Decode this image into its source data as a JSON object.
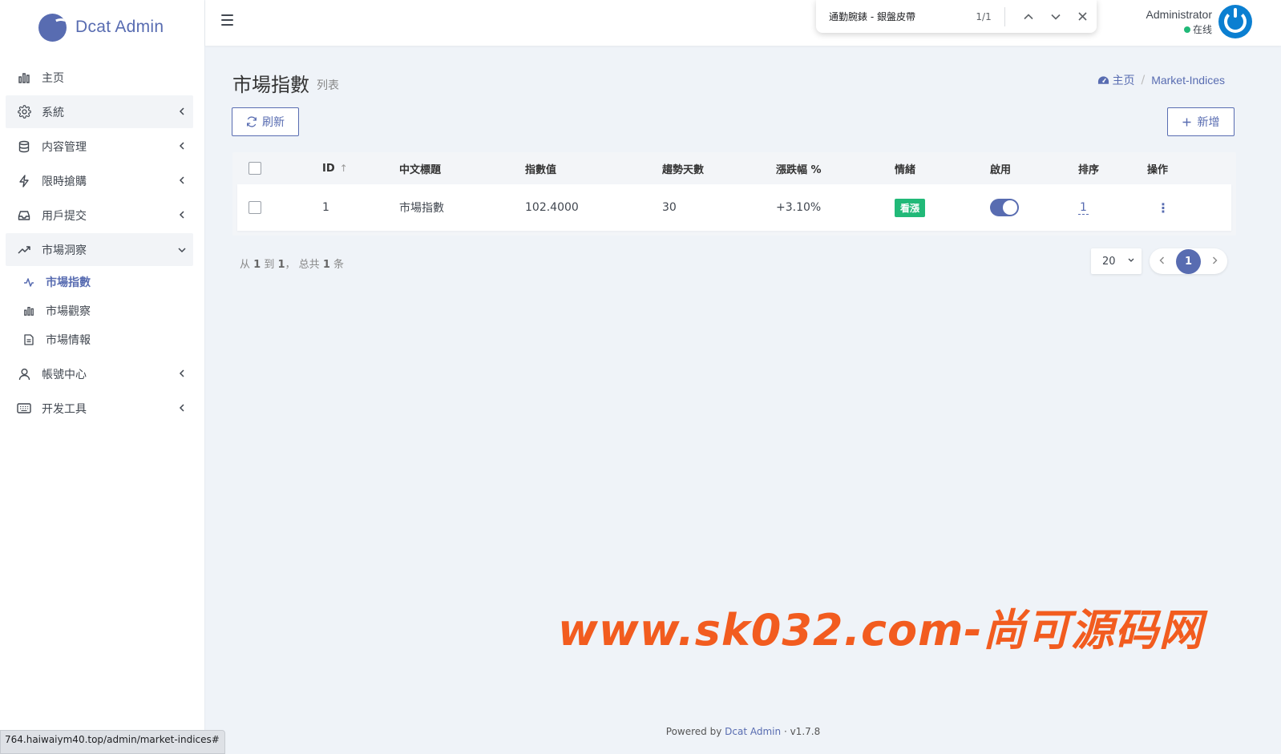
{
  "brand": {
    "name": "Dcat Admin"
  },
  "sidebar": {
    "items": [
      {
        "label": "主页",
        "icon": "bar-chart-icon",
        "expandable": false
      },
      {
        "label": "系統",
        "icon": "gear-icon",
        "expandable": true
      },
      {
        "label": "内容管理",
        "icon": "database-icon",
        "expandable": true
      },
      {
        "label": "限時搶購",
        "icon": "lightning-icon",
        "expandable": true
      },
      {
        "label": "用戶提交",
        "icon": "inbox-icon",
        "expandable": true
      },
      {
        "label": "市場洞察",
        "icon": "trend-up-icon",
        "expandable": true,
        "expanded": true
      },
      {
        "label": "帳號中心",
        "icon": "user-icon",
        "expandable": true
      },
      {
        "label": "开发工具",
        "icon": "keyboard-icon",
        "expandable": true
      }
    ],
    "submenu": [
      {
        "label": "市場指數",
        "icon": "pulse-icon",
        "active": true
      },
      {
        "label": "市場觀察",
        "icon": "bar-chart-icon",
        "active": false
      },
      {
        "label": "市場情報",
        "icon": "document-icon",
        "active": false
      }
    ]
  },
  "navbar": {
    "user_name": "Administrator",
    "user_status": "在线",
    "status_color": "#21b978"
  },
  "findbar": {
    "query": "通勤腕錶 - 銀盤皮帶",
    "count": "1/1"
  },
  "page": {
    "title": "市場指數",
    "description": "列表",
    "breadcrumb_home": "主页",
    "breadcrumb_current": "Market-Indices"
  },
  "toolbar": {
    "refresh_label": "刷新",
    "new_label": "新增"
  },
  "table": {
    "headers": {
      "id": "ID",
      "title": "中文標題",
      "value": "指數值",
      "days": "趨勢天數",
      "pct": "漲跌幅 %",
      "mood": "情緒",
      "enabled": "啟用",
      "sort": "排序",
      "ops": "操作"
    },
    "rows": [
      {
        "id": "1",
        "title": "市場指數",
        "value": "102.4000",
        "days": "30",
        "pct": "+3.10%",
        "mood": "看漲",
        "enabled": true,
        "sort": "1"
      }
    ]
  },
  "pager": {
    "info_prefix": "从",
    "from": "1",
    "to_word": "到",
    "to": "1",
    "total_prefix": "， 总共",
    "total": "1",
    "total_suffix": "条",
    "per_page": "20",
    "current_page": "1"
  },
  "watermark": "www.sk032.com-尚可源码网",
  "footer": {
    "powered_by": "Powered by",
    "link": "Dcat Admin",
    "version": "· v1.7.8"
  },
  "status_url": "764.haiwaiym40.top/admin/market-indices#",
  "colors": {
    "accent": "#586cb1",
    "success": "#21b978",
    "watermark": "#f25c1f"
  }
}
